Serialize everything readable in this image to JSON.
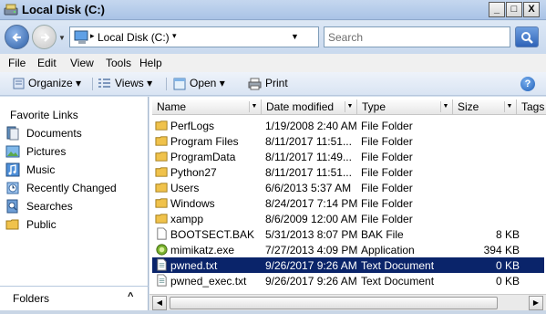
{
  "window": {
    "title": "Local Disk (C:)",
    "min": "_",
    "max": "□",
    "close": "X"
  },
  "address": {
    "text": "Local Disk (C:)",
    "go_label": "→"
  },
  "search": {
    "placeholder": "Search"
  },
  "menu": [
    "File",
    "Edit",
    "View",
    "Tools",
    "Help"
  ],
  "toolbar": {
    "organize": "Organize",
    "views": "Views",
    "open": "Open",
    "print": "Print",
    "help": "?"
  },
  "sidebar": {
    "title": "Favorite Links",
    "items": [
      "Documents",
      "Pictures",
      "Music",
      "Recently Changed",
      "Searches",
      "Public"
    ],
    "folders_label": "Folders"
  },
  "columns": {
    "name": "Name",
    "date": "Date modified",
    "type": "Type",
    "size": "Size",
    "tags": "Tags"
  },
  "files": [
    {
      "name": "PerfLogs",
      "date": "1/19/2008 2:40 AM",
      "type": "File Folder",
      "size": "",
      "icon": "folder-icon"
    },
    {
      "name": "Program Files",
      "date": "8/11/2017 11:51...",
      "type": "File Folder",
      "size": "",
      "icon": "folder-icon"
    },
    {
      "name": "ProgramData",
      "date": "8/11/2017 11:49...",
      "type": "File Folder",
      "size": "",
      "icon": "folder-icon"
    },
    {
      "name": "Python27",
      "date": "8/11/2017 11:51...",
      "type": "File Folder",
      "size": "",
      "icon": "folder-icon"
    },
    {
      "name": "Users",
      "date": "6/6/2013 5:37 AM",
      "type": "File Folder",
      "size": "",
      "icon": "folder-icon"
    },
    {
      "name": "Windows",
      "date": "8/24/2017 7:14 PM",
      "type": "File Folder",
      "size": "",
      "icon": "folder-icon"
    },
    {
      "name": "xampp",
      "date": "8/6/2009 12:00 AM",
      "type": "File Folder",
      "size": "",
      "icon": "folder-icon"
    },
    {
      "name": "BOOTSECT.BAK",
      "date": "5/31/2013 8:07 PM",
      "type": "BAK File",
      "size": "8 KB",
      "icon": "file-icon"
    },
    {
      "name": "mimikatz.exe",
      "date": "7/27/2013 4:09 PM",
      "type": "Application",
      "size": "394 KB",
      "icon": "app-icon"
    },
    {
      "name": "pwned.txt",
      "date": "9/26/2017 9:26 AM",
      "type": "Text Document",
      "size": "0 KB",
      "icon": "text-file-icon",
      "selected": true
    },
    {
      "name": "pwned_exec.txt",
      "date": "9/26/2017 9:26 AM",
      "type": "Text Document",
      "size": "0 KB",
      "icon": "text-file-icon"
    }
  ]
}
